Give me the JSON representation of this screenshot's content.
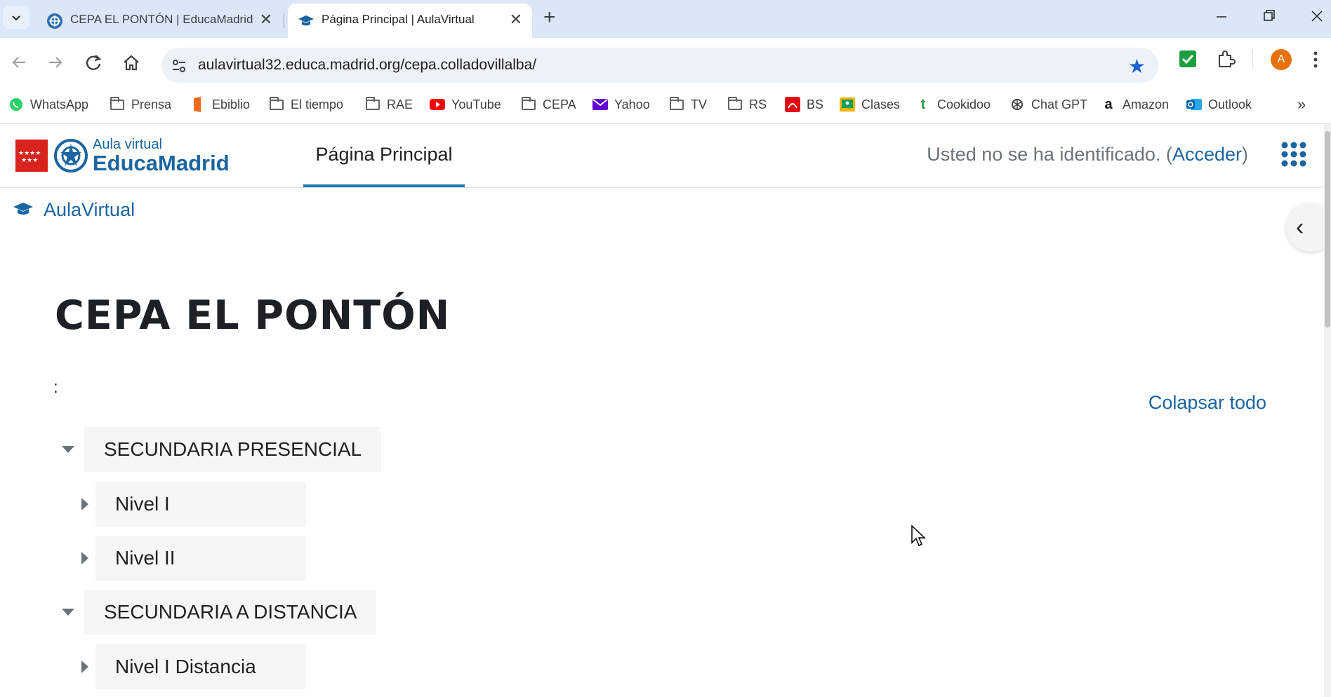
{
  "browser": {
    "tabs": [
      {
        "title": "CEPA EL PONTÓN | EducaMadrid",
        "active": false
      },
      {
        "title": "Página Principal | AulaVirtual",
        "active": true
      }
    ],
    "url": "aulavirtual32.educa.madrid.org/cepa.colladovillalba/",
    "profile_initial": "A",
    "bookmarks": [
      {
        "label": "WhatsApp",
        "icon": "whatsapp-icon"
      },
      {
        "label": "Prensa",
        "icon": "folder-icon"
      },
      {
        "label": "Ebiblio",
        "icon": "ebiblio-icon"
      },
      {
        "label": "El tiempo",
        "icon": "folder-icon"
      },
      {
        "label": "RAE",
        "icon": "folder-icon"
      },
      {
        "label": "YouTube",
        "icon": "youtube-icon"
      },
      {
        "label": "CEPA",
        "icon": "folder-icon"
      },
      {
        "label": "Yahoo",
        "icon": "yahoo-mail-icon"
      },
      {
        "label": "TV",
        "icon": "folder-icon"
      },
      {
        "label": "RS",
        "icon": "folder-icon"
      },
      {
        "label": "BS",
        "icon": "bs-icon"
      },
      {
        "label": "Clases",
        "icon": "classroom-icon"
      },
      {
        "label": "Cookidoo",
        "icon": "cookidoo-icon"
      },
      {
        "label": "Chat GPT",
        "icon": "chatgpt-icon"
      },
      {
        "label": "Amazon",
        "icon": "amazon-icon"
      },
      {
        "label": "Outlook",
        "icon": "outlook-icon"
      }
    ]
  },
  "site": {
    "logo_line1": "Aula virtual",
    "logo_line2": "EducaMadrid",
    "nav_main": "Página Principal",
    "login_prefix": "Usted no se ha identificado. (",
    "login_link": "Acceder",
    "login_suffix": ")",
    "breadcrumb": "AulaVirtual",
    "site_name": "CEPA EL PONTÓN",
    "colon": ":",
    "collapse_all": "Colapsar todo",
    "categories": [
      {
        "label": "SECUNDARIA PRESENCIAL",
        "expanded": true,
        "level": 0
      },
      {
        "label": "Nivel I",
        "expanded": false,
        "level": 1
      },
      {
        "label": "Nivel II",
        "expanded": false,
        "level": 1
      },
      {
        "label": "SECUNDARIA A DISTANCIA",
        "expanded": true,
        "level": 0
      },
      {
        "label": "Nivel I Distancia",
        "expanded": false,
        "level": 1
      }
    ]
  },
  "colors": {
    "link": "#1a65a1",
    "accent": "#1a7bb9",
    "tabstrip": "#dbe6f6"
  }
}
